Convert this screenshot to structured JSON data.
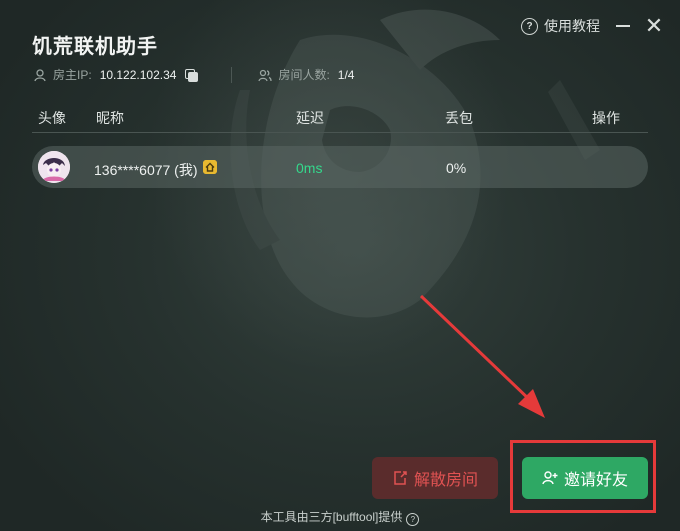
{
  "window": {
    "title": "饥荒联机助手",
    "help_label": "使用教程",
    "help_icon": "question-circle-icon",
    "close_glyph": "✕"
  },
  "room_info": {
    "host_ip_label": "房主IP:",
    "host_ip": "10.122.102.34",
    "player_count_label": "房间人数:",
    "player_count": "1/4"
  },
  "table": {
    "headers": [
      "头像",
      "昵称",
      "延迟",
      "丢包",
      "操作"
    ],
    "rows": [
      {
        "nickname": "136****6077 (我)",
        "latency": "0ms",
        "packet_loss": "0%",
        "is_host": true
      }
    ]
  },
  "actions": {
    "dissolve_label": "解散房间",
    "invite_label": "邀请好友"
  },
  "footer": {
    "text": "本工具由三方[bufftool]提供"
  },
  "colors": {
    "accent_green": "#2ea864",
    "latency_green": "#34d98c",
    "danger_red": "#e05252",
    "annotation_red": "#e53a3a",
    "host_badge": "#e8b930"
  }
}
